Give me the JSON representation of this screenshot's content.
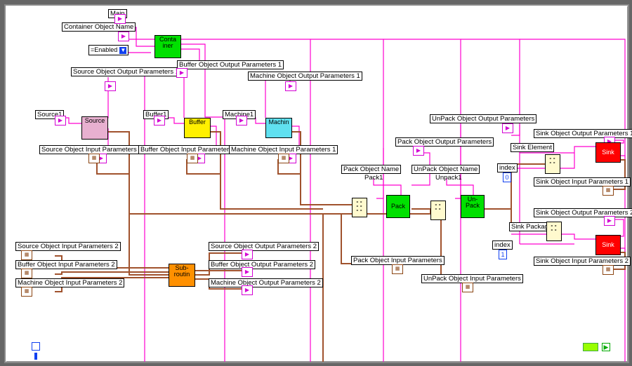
{
  "labels": {
    "main": "Main",
    "container": "Container Object Name",
    "enabled": "=Enabled",
    "source1": "Source1",
    "src_out1": "Source Object Output Parameters 1",
    "src_in1": "Source Object Input Parameters 1",
    "buf_out1": "Buffer Object Output Parameters 1",
    "buffer1": "Buffer1",
    "buf_in1": "Buffer Object Input Parameters 1",
    "mach_out1": "Machine Object Output Parameters 1",
    "machine1": "Machine1",
    "mach_in1": "Machine Object Input Parameters 1",
    "src_in2": "Source Object Input Parameters 2",
    "buf_in2": "Buffer Object Input Parameters 2",
    "mach_in2": "Machine Object Input Parameters 2",
    "src_out2": "Source Object Output Parameters 2",
    "buf_out2": "Buffer Object Output Parameters 2",
    "mach_out2": "Machine Object Output Parameters 2",
    "packname": "Pack Object Name",
    "pack1": "Pack1",
    "pack_out": "Pack Object Output Parameters",
    "pack_in": "Pack Object Input Parameters",
    "unpackname": "UnPack Object Name",
    "unpack1": "Unpack1",
    "unpack_out": "UnPack Object Output Parameters",
    "unpack_in": "UnPack Object Input Parameters",
    "sinkel": "Sink Element",
    "sinkpkg": "Sink Package",
    "sink_out1": "Sink Object Output Parameters 1",
    "sink_in1": "Sink Object Input Parameters 1",
    "sink_out2": "Sink Object Output Parameters 2",
    "sink_in2": "Sink Object Input Parameters 2",
    "index": "index",
    "i0": "0",
    "i1": "1",
    "n_cont": "Conta\niner",
    "n_src": "Source",
    "n_buf": "Buffer",
    "n_mach": "Machin",
    "n_sub": "Sub-\nroutin",
    "n_pack": "Pack",
    "n_unpack": "Un-\nPack",
    "n_sink": "Sink",
    "dd": "▼",
    "ga": "▶"
  }
}
